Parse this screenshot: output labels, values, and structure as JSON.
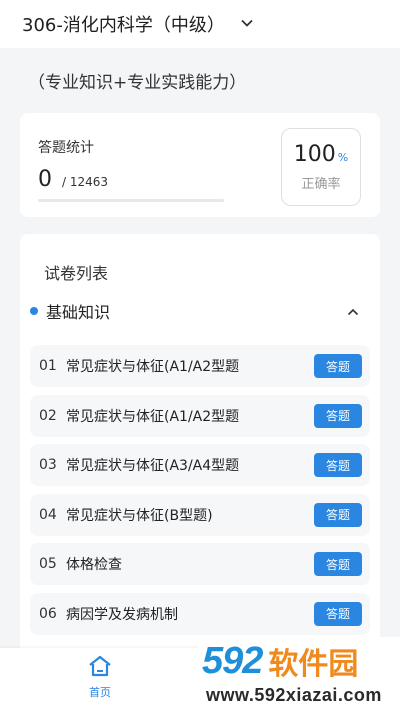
{
  "header": {
    "title": "306-消化内科学（中级）",
    "dropdown_icon": "chevron-down-icon"
  },
  "subtitle": "（专业知识+专业实践能力）",
  "stats": {
    "label": "答题统计",
    "answered": "0",
    "total": "/ 12463",
    "progress_fraction": 0,
    "accuracy_value": "100",
    "accuracy_unit": "%",
    "accuracy_label": "正确率"
  },
  "papers": {
    "title": "试卷列表",
    "section": {
      "name": "基础知识",
      "collapse_icon": "chevron-up-icon"
    },
    "items": [
      {
        "index": "01",
        "name": "常见症状与体征(A1/A2型题",
        "button": "答题"
      },
      {
        "index": "02",
        "name": "常见症状与体征(A1/A2型题",
        "button": "答题"
      },
      {
        "index": "03",
        "name": "常见症状与体征(A3/A4型题",
        "button": "答题"
      },
      {
        "index": "04",
        "name": "常见症状与体征(B型题)",
        "button": "答题"
      },
      {
        "index": "05",
        "name": "体格检查",
        "button": "答题"
      },
      {
        "index": "06",
        "name": "病因学及发病机制",
        "button": "答题"
      }
    ]
  },
  "bottom_nav": {
    "home_label": "首页",
    "home_icon": "home-icon"
  },
  "watermark": {
    "number": "592",
    "name": "软件园",
    "url": "www.592xiazai.com"
  },
  "colors": {
    "accent": "#2a86e0",
    "watermark_blue": "#1e8fd8",
    "watermark_orange": "#f08a1c"
  }
}
